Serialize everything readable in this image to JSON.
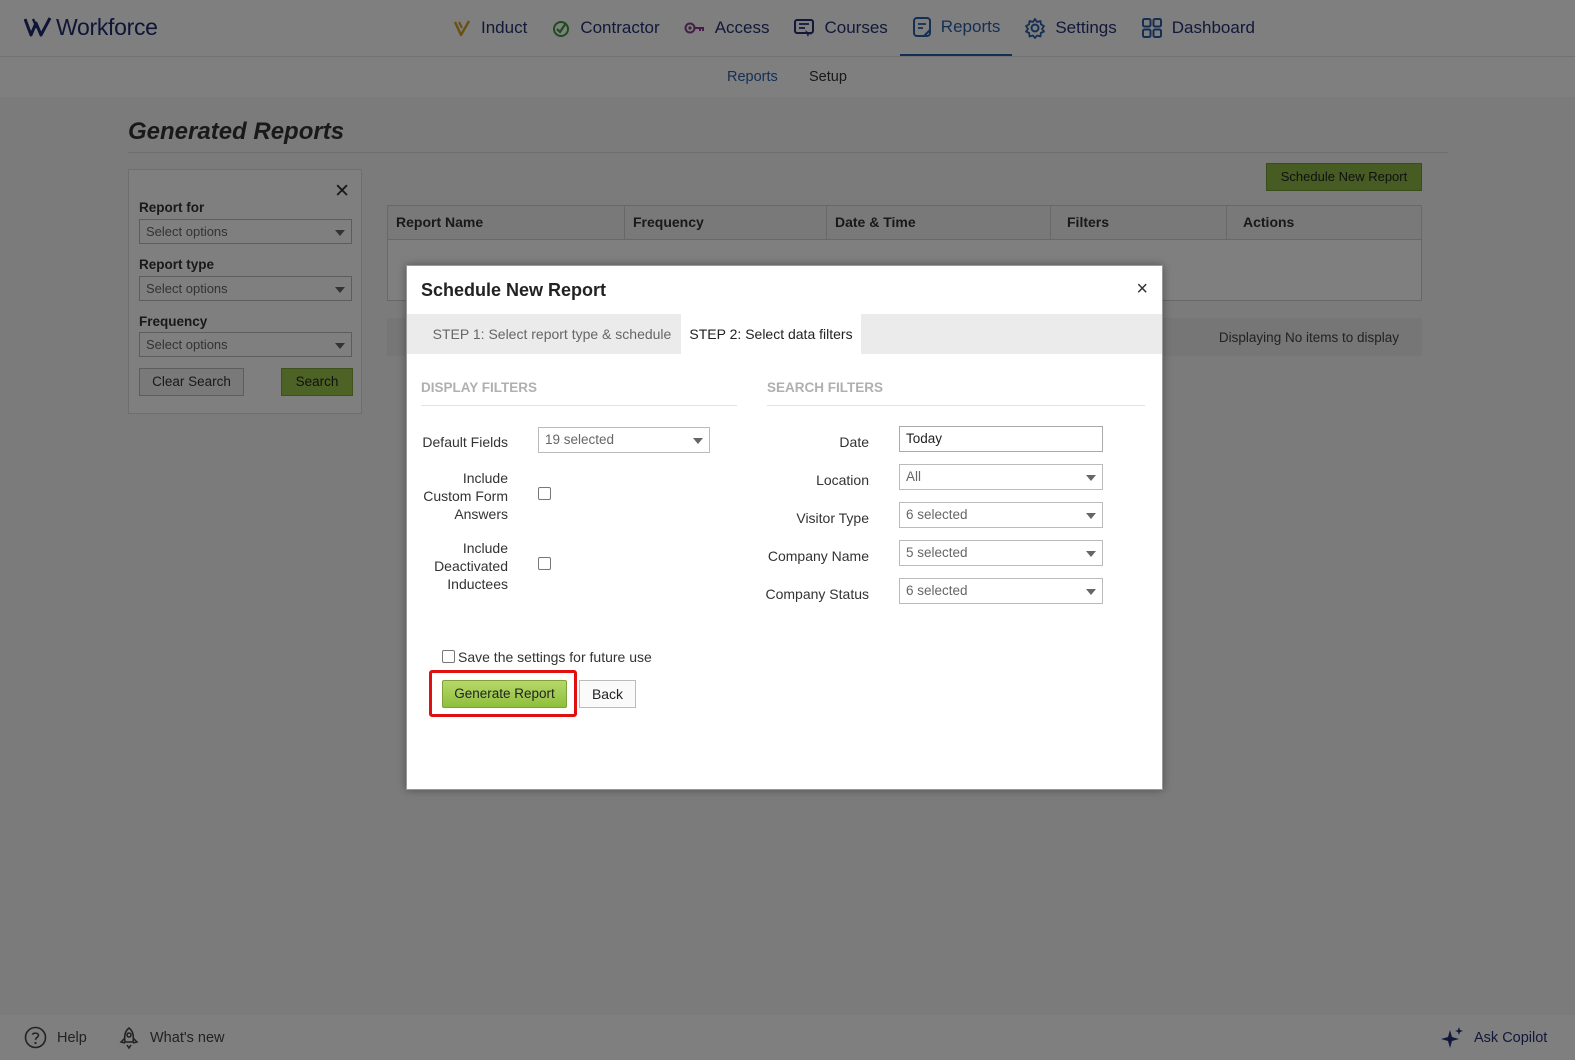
{
  "brand": {
    "name": "Workforce"
  },
  "nav": {
    "items": [
      {
        "label": "Induct",
        "icon": "induct-icon"
      },
      {
        "label": "Contractor",
        "icon": "contractor-icon"
      },
      {
        "label": "Access",
        "icon": "key-icon"
      },
      {
        "label": "Courses",
        "icon": "courses-icon"
      },
      {
        "label": "Reports",
        "icon": "reports-icon",
        "active": true
      },
      {
        "label": "Settings",
        "icon": "gear-icon"
      },
      {
        "label": "Dashboard",
        "icon": "dashboard-icon"
      }
    ]
  },
  "subnav": {
    "items": [
      {
        "label": "Reports",
        "active": true
      },
      {
        "label": "Setup"
      }
    ]
  },
  "page": {
    "title": "Generated Reports"
  },
  "filters": {
    "close": "✕",
    "report_for": {
      "label": "Report for",
      "placeholder": "Select options"
    },
    "report_type": {
      "label": "Report type",
      "placeholder": "Select options"
    },
    "frequency": {
      "label": "Frequency",
      "placeholder": "Select options"
    },
    "clear_label": "Clear Search",
    "search_label": "Search"
  },
  "schedule_button": "Schedule New Report",
  "table": {
    "columns": [
      "Report Name",
      "Frequency",
      "Date & Time",
      "Filters",
      "Actions"
    ],
    "pager_text": "Displaying No items to display"
  },
  "modal": {
    "title": "Schedule New Report",
    "close": "×",
    "tabs": [
      {
        "label": "STEP 1: Select report type & schedule",
        "active": false
      },
      {
        "label": "STEP 2: Select data filters",
        "active": true
      }
    ],
    "display_filters": {
      "heading": "DISPLAY FILTERS",
      "default_fields": {
        "label": "Default Fields",
        "value": "19 selected"
      },
      "custom_form": {
        "label_lines": [
          "Include",
          "Custom Form",
          "Answers"
        ],
        "checked": false
      },
      "deactivated": {
        "label_lines": [
          "Include",
          "Deactivated",
          "Inductees"
        ],
        "checked": false
      }
    },
    "search_filters": {
      "heading": "SEARCH FILTERS",
      "date": {
        "label": "Date",
        "value": "Today"
      },
      "location": {
        "label": "Location",
        "value": "All"
      },
      "visitor_type": {
        "label": "Visitor Type",
        "value": "6 selected"
      },
      "company_name": {
        "label": "Company Name",
        "value": "5 selected"
      },
      "company_status": {
        "label": "Company Status",
        "value": "6 selected"
      }
    },
    "save_settings": {
      "label": "Save the settings for future use",
      "checked": false
    },
    "generate_label": "Generate Report",
    "back_label": "Back"
  },
  "footer": {
    "help": "Help",
    "whats_new": "What's new",
    "copilot": "Ask Copilot"
  },
  "colors": {
    "brand_navy": "#1f2b6e",
    "active_blue": "#2a5ea8",
    "button_green": "#9bc44a",
    "highlight_red": "#e01010"
  }
}
